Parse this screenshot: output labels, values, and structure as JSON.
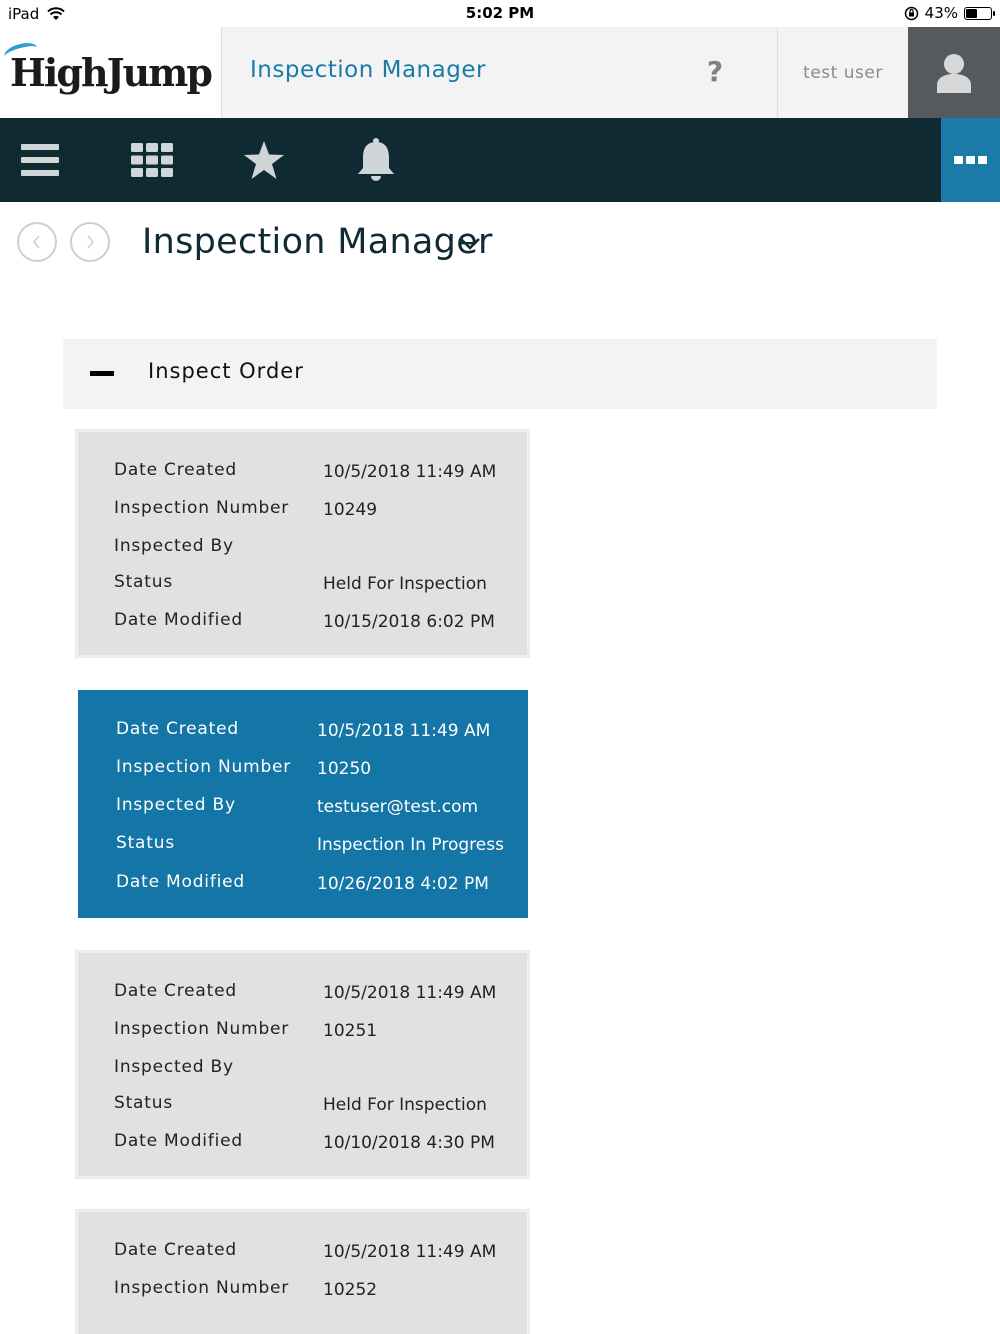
{
  "status_bar": {
    "carrier": "iPad",
    "time": "5:02 PM",
    "battery": "43%",
    "battery_level": 0.43
  },
  "header": {
    "logo": "HighJump",
    "app_title": "Inspection Manager",
    "help": "?",
    "user": "test user"
  },
  "toolbar": {
    "icons": [
      "menu-icon",
      "grid-icon",
      "star-icon",
      "bell-icon",
      "more-icon"
    ]
  },
  "breadcrumb": {
    "title": "Inspection Manager"
  },
  "section": {
    "title": "Inspect Order"
  },
  "labels": {
    "date_created": "Date Created",
    "inspection_number": "Inspection Number",
    "inspected_by": "Inspected By",
    "status": "Status",
    "date_modified": "Date Modified"
  },
  "cards": [
    {
      "date_created": "10/5/2018 11:49 AM",
      "inspection_number": "10249",
      "inspected_by": "",
      "status": "Held For Inspection",
      "date_modified": "10/15/2018 6:02 PM"
    },
    {
      "date_created": "10/5/2018 11:49 AM",
      "inspection_number": "10250",
      "inspected_by": "testuser@test.com",
      "status": "Inspection In Progress",
      "date_modified": "10/26/2018 4:02 PM"
    },
    {
      "date_created": "10/5/2018 11:49 AM",
      "inspection_number": "10251",
      "inspected_by": "",
      "status": "Held For Inspection",
      "date_modified": "10/10/2018 4:30 PM"
    },
    {
      "date_created": "10/5/2018 11:49 AM",
      "inspection_number": "10252"
    }
  ],
  "colors": {
    "accent": "#1a7aa8",
    "toolbar": "#0f2a33",
    "card": "#e1e1e1",
    "selected_card": "#1476a6"
  }
}
